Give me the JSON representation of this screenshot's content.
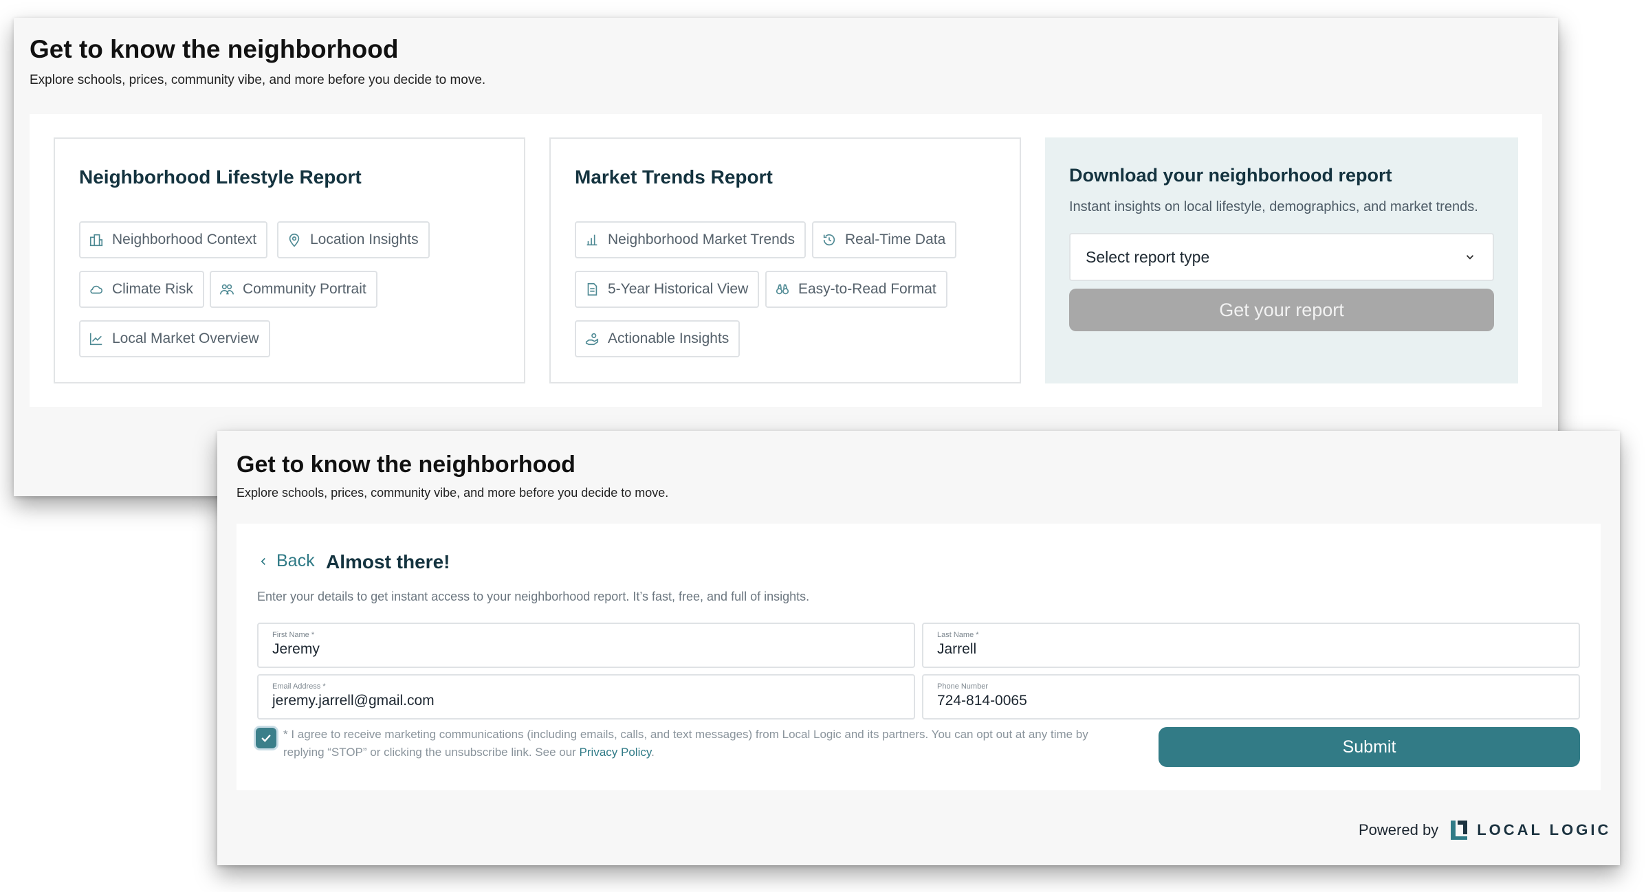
{
  "top": {
    "title": "Get to know the neighborhood",
    "subtitle": "Explore schools, prices, community vibe, and more before you decide to move.",
    "lifestyle": {
      "title": "Neighborhood Lifestyle Report",
      "chips": [
        "Neighborhood Context",
        "Location Insights",
        "Climate Risk",
        "Community Portrait",
        "Local Market Overview"
      ]
    },
    "market": {
      "title": "Market Trends Report",
      "chips": [
        "Neighborhood Market Trends",
        "Real-Time Data",
        "5-Year Historical View",
        "Easy-to-Read Format",
        "Actionable Insights"
      ]
    },
    "download": {
      "title": "Download your neighborhood report",
      "subtitle": "Instant insights on local lifestyle, demographics, and market trends.",
      "select_value": "Select report type",
      "button": "Get your report"
    }
  },
  "bottom": {
    "title": "Get to know the neighborhood",
    "subtitle": "Explore schools, prices, community vibe, and more before you decide to move.",
    "back": "Back",
    "heading": "Almost there!",
    "instructions": "Enter your details to get instant access to your neighborhood report. It’s fast, free, and full of insights.",
    "fields": {
      "first_name": {
        "label": "First Name *",
        "value": "Jeremy"
      },
      "last_name": {
        "label": "Last Name *",
        "value": "Jarrell"
      },
      "email": {
        "label": "Email Address *",
        "value": "jeremy.jarrell@gmail.com"
      },
      "phone": {
        "label": "Phone Number",
        "value": "724-814-0065"
      }
    },
    "consent": {
      "text": "* I agree to receive marketing communications (including emails, calls, and text messages) from Local Logic and its partners. You can opt out at any time by replying “STOP” or clicking the unsubscribe link. See our ",
      "link": "Privacy Policy",
      "end": ".",
      "checked": true
    },
    "submit": "Submit",
    "powered_by": "Powered by",
    "logo_text": "LOCAL LOGIC"
  },
  "colors": {
    "accent": "#327b86",
    "heading": "#14333f",
    "download_bg": "#e9f1f2",
    "disabled_button": "#a8a8a8"
  }
}
